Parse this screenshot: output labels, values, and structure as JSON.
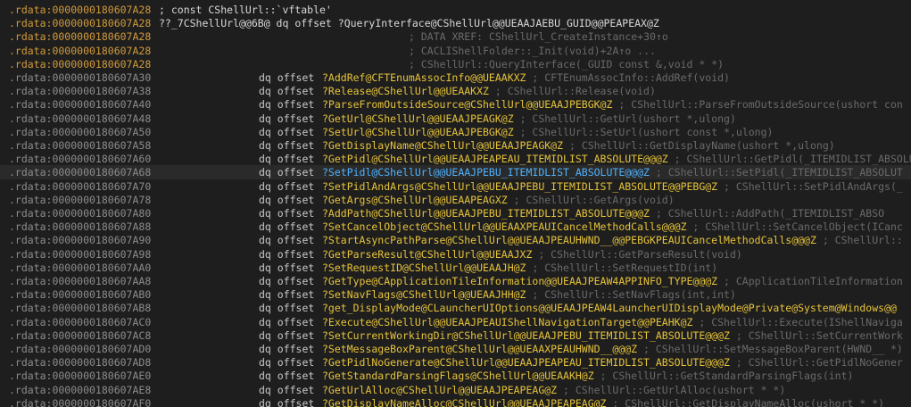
{
  "lines": [
    {
      "addr": ".rdata:0000000180607A28",
      "text": "; const CShellUrl::`vftable'",
      "kind": "header"
    },
    {
      "addr": ".rdata:0000000180607A28",
      "text": "??_7CShellUrl@@6B@ dq offset ?QueryInterface@CShellUrl@@UEAAJAEBU_GUID@@PEAPEAX@Z",
      "kind": "header"
    },
    {
      "addr": ".rdata:0000000180607A28",
      "text": "; DATA XREF: CShellUrl_CreateInstance+30↑o",
      "kind": "xref"
    },
    {
      "addr": ".rdata:0000000180607A28",
      "text": "; CACLIShellFolder::_Init(void)+2A↑o ...",
      "kind": "xref"
    },
    {
      "addr": ".rdata:0000000180607A28",
      "text": "; CShellUrl::QueryInterface(_GUID const &,void * *)",
      "kind": "xref"
    },
    {
      "addr": ".rdata:0000000180607A30",
      "op": "dq offset",
      "sym": "?AddRef@CFTEnumAssocInfo@@UEAAKXZ",
      "cmt": " ; CFTEnumAssocInfo::AddRef(void)"
    },
    {
      "addr": ".rdata:0000000180607A38",
      "op": "dq offset",
      "sym": "?Release@CShellUrl@@UEAAKXZ",
      "cmt": " ; CShellUrl::Release(void)"
    },
    {
      "addr": ".rdata:0000000180607A40",
      "op": "dq offset",
      "sym": "?ParseFromOutsideSource@CShellUrl@@UEAAJPEBGK@Z",
      "cmt": " ; CShellUrl::ParseFromOutsideSource(ushort con"
    },
    {
      "addr": ".rdata:0000000180607A48",
      "op": "dq offset",
      "sym": "?GetUrl@CShellUrl@@UEAAJPEAGK@Z",
      "cmt": " ; CShellUrl::GetUrl(ushort *,ulong)"
    },
    {
      "addr": ".rdata:0000000180607A50",
      "op": "dq offset",
      "sym": "?SetUrl@CShellUrl@@UEAAJPEBGK@Z",
      "cmt": " ; CShellUrl::SetUrl(ushort const *,ulong)"
    },
    {
      "addr": ".rdata:0000000180607A58",
      "op": "dq offset",
      "sym": "?GetDisplayName@CShellUrl@@UEAAJPEAGK@Z",
      "cmt": " ; CShellUrl::GetDisplayName(ushort *,ulong)"
    },
    {
      "addr": ".rdata:0000000180607A60",
      "op": "dq offset",
      "sym": "?GetPidl@CShellUrl@@UEAAJPEAPEAU_ITEMIDLIST_ABSOLUTE@@@Z",
      "cmt": " ; CShellUrl::GetPidl(_ITEMIDLIST_ABSOLU"
    },
    {
      "addr": ".rdata:0000000180607A68",
      "op": "dq offset",
      "sym": "?SetPidl@CShellUrl@@UEAAJPEBU_ITEMIDLIST_ABSOLUTE@@@Z",
      "cmt": " ; CShellUrl::SetPidl(_ITEMIDLIST_ABSOLUT",
      "selected": true
    },
    {
      "addr": ".rdata:0000000180607A70",
      "op": "dq offset",
      "sym": "?SetPidlAndArgs@CShellUrl@@UEAAJPEBU_ITEMIDLIST_ABSOLUTE@@PEBG@Z",
      "cmt": " ; CShellUrl::SetPidlAndArgs(_"
    },
    {
      "addr": ".rdata:0000000180607A78",
      "op": "dq offset",
      "sym": "?GetArgs@CShellUrl@@UEAAPEAGXZ",
      "cmt": " ; CShellUrl::GetArgs(void)"
    },
    {
      "addr": ".rdata:0000000180607A80",
      "op": "dq offset",
      "sym": "?AddPath@CShellUrl@@UEAAJPEBU_ITEMIDLIST_ABSOLUTE@@@Z",
      "cmt": " ; CShellUrl::AddPath(_ITEMIDLIST_ABSO"
    },
    {
      "addr": ".rdata:0000000180607A88",
      "op": "dq offset",
      "sym": "?SetCancelObject@CShellUrl@@UEAAXPEAUICancelMethodCalls@@@Z",
      "cmt": " ; CShellUrl::SetCancelObject(ICanc"
    },
    {
      "addr": ".rdata:0000000180607A90",
      "op": "dq offset",
      "sym": "?StartAsyncPathParse@CShellUrl@@UEAAJPEAUHWND__@@PEBGKPEAUICancelMethodCalls@@@Z",
      "cmt": " ; CShellUrl::"
    },
    {
      "addr": ".rdata:0000000180607A98",
      "op": "dq offset",
      "sym": "?GetParseResult@CShellUrl@@UEAAJXZ",
      "cmt": " ; CShellUrl::GetParseResult(void)"
    },
    {
      "addr": ".rdata:0000000180607AA0",
      "op": "dq offset",
      "sym": "?SetRequestID@CShellUrl@@UEAAJH@Z",
      "cmt": " ; CShellUrl::SetRequestID(int)"
    },
    {
      "addr": ".rdata:0000000180607AA8",
      "op": "dq offset",
      "sym": "?GetType@CApplicationTileInformation@@UEAAJPEAW4APPINFO_TYPE@@@Z",
      "cmt": " ; CApplicationTileInformation"
    },
    {
      "addr": ".rdata:0000000180607AB0",
      "op": "dq offset",
      "sym": "?SetNavFlags@CShellUrl@@UEAAJHH@Z",
      "cmt": " ; CShellUrl::SetNavFlags(int,int)"
    },
    {
      "addr": ".rdata:0000000180607AB8",
      "op": "dq offset",
      "sym": "?get_DisplayMode@CLauncherUIOptions@@UEAAJPEAW4LauncherUIDisplayMode@Private@System@Windows@@",
      "cmt": ""
    },
    {
      "addr": ".rdata:0000000180607AC0",
      "op": "dq offset",
      "sym": "?Execute@CShellUrl@@UEAAJPEAUIShellNavigationTarget@@PEAHK@Z",
      "cmt": " ; CShellUrl::Execute(IShellNaviga"
    },
    {
      "addr": ".rdata:0000000180607AC8",
      "op": "dq offset",
      "sym": "?SetCurrentWorkingDir@CShellUrl@@UEAAJPEBU_ITEMIDLIST_ABSOLUTE@@@Z",
      "cmt": " ; CShellUrl::SetCurrentWork"
    },
    {
      "addr": ".rdata:0000000180607AD0",
      "op": "dq offset",
      "sym": "?SetMessageBoxParent@CShellUrl@@UEAAXPEAUHWND__@@@Z",
      "cmt": " ; CShellUrl::SetMessageBoxParent(HWND__ *)"
    },
    {
      "addr": ".rdata:0000000180607AD8",
      "op": "dq offset",
      "sym": "?GetPidlNoGenerate@CShellUrl@@UEAAJPEAPEAU_ITEMIDLIST_ABSOLUTE@@@Z",
      "cmt": " ; CShellUrl::GetPidlNoGener"
    },
    {
      "addr": ".rdata:0000000180607AE0",
      "op": "dq offset",
      "sym": "?GetStandardParsingFlags@CShellUrl@@UEAAKH@Z",
      "cmt": " ; CShellUrl::GetStandardParsingFlags(int)"
    },
    {
      "addr": ".rdata:0000000180607AE8",
      "op": "dq offset",
      "sym": "?GetUrlAlloc@CShellUrl@@UEAAJPEAPEAG@Z",
      "cmt": " ; CShellUrl::GetUrlAlloc(ushort * *)"
    },
    {
      "addr": ".rdata:0000000180607AF0",
      "op": "dq offset",
      "sym": "?GetDisplayNameAlloc@CShellUrl@@UEAAJPEAPEAG@Z",
      "cmt": " ; CShellUrl::GetDisplayNameAlloc(ushort * *)"
    }
  ],
  "colors": {
    "background": "#1e1e1e",
    "address": "#8c8c8c",
    "address_header": "#d19a3a",
    "symbol": "#e6c33a",
    "symbol_selected": "#4fb3ff",
    "comment": "#6a6a6a"
  }
}
